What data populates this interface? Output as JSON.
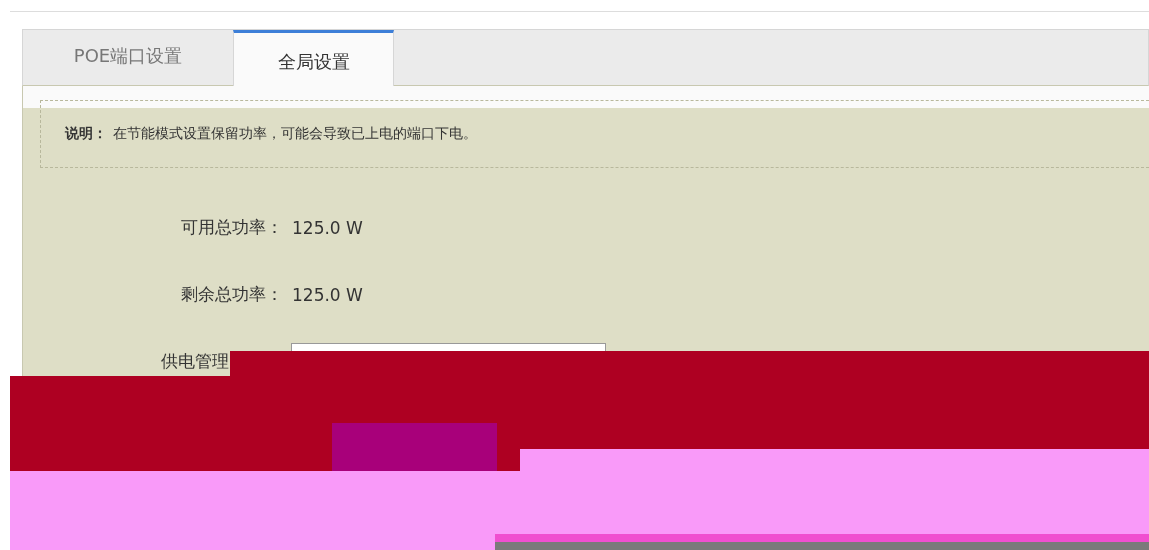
{
  "tabs": [
    {
      "label": "POE端口设置",
      "selected": false
    },
    {
      "label": "全局设置",
      "selected": true
    }
  ],
  "note": {
    "label": "说明：",
    "text": "在节能模式设置保留功率，可能会导致已上电的端口下电。"
  },
  "fields": [
    {
      "label": "可用总功率：",
      "value": "125.0 W",
      "kind": "text"
    },
    {
      "label": "剩余总功率：",
      "value": "125.0 W",
      "kind": "text"
    },
    {
      "label": "供电管理",
      "kind": "select"
    }
  ]
}
